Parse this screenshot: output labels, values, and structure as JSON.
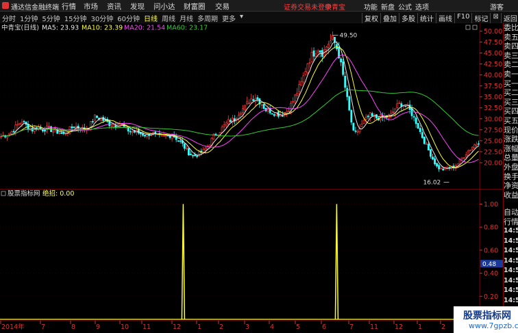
{
  "titlebar": {
    "app_name": "通达信金融终端",
    "menu": [
      "行情",
      "市场",
      "资讯",
      "发现",
      "问小达",
      "财富圈",
      "交易"
    ],
    "notice": "证券交易未登录",
    "stock_name": "中青宝",
    "right_links": [
      "功能",
      "新盘",
      "公式",
      "选项"
    ],
    "guest": "游客"
  },
  "period_bar": {
    "items": [
      "分时",
      "1分钟",
      "5分钟",
      "15分钟",
      "30分钟",
      "60分钟",
      "日线",
      "周线",
      "月线",
      "多周期",
      "更多"
    ],
    "active": "日线",
    "right_tools": [
      "复权",
      "叠加",
      "多股",
      "统计",
      "画线",
      "F10",
      "标记",
      "返回"
    ]
  },
  "kline": {
    "stock_label": "中青宝(日线)",
    "ma_legend": [
      {
        "name": "MA5",
        "value": "23.93",
        "color": "#e8e8e8"
      },
      {
        "name": "MA10",
        "value": "23.39",
        "color": "#ffff33"
      },
      {
        "name": "MA20",
        "value": "21.54",
        "color": "#ff44ff"
      },
      {
        "name": "MA60",
        "value": "23.17",
        "color": "#33cc33"
      }
    ],
    "high_label": "49.50",
    "low_label": "16.02"
  },
  "indicator": {
    "title": "股票指标网",
    "signal_label": "绝招: 0.00",
    "current_value_tag": "0.48"
  },
  "time_axis": [
    "2014年",
    "7",
    "8",
    "9",
    "10",
    "11",
    "12",
    "1",
    "2",
    "3",
    "4",
    "5",
    "6",
    "7",
    "11",
    "12",
    "1",
    "2",
    "3"
  ],
  "side_panel": {
    "items": [
      "委比",
      "卖五",
      "卖四",
      "卖三",
      "卖二",
      "卖一",
      "买一",
      "买二",
      "买三",
      "买四",
      "买五",
      "现价",
      "涨跌",
      "涨幅",
      "总量",
      "外盘",
      "换手",
      "净资",
      "收益"
    ],
    "trade_items": [
      "自动",
      "行情"
    ],
    "times": [
      "14:50",
      "14:50",
      "14:50",
      "14:50",
      "14:50",
      "14:50",
      "14:50",
      "14:50"
    ]
  },
  "watermark": {
    "text": "股票指标网",
    "url": "www.7gpzb.com"
  },
  "chart_data": {
    "type": "candlestick",
    "ylim": [
      15,
      51
    ],
    "price_ticks": [
      50,
      47.5,
      45,
      42.5,
      40,
      37.5,
      35,
      32.5,
      30,
      27.5,
      25,
      22.5,
      20
    ],
    "price_tick_labels": [
      "50.00",
      "47.50",
      "45.00",
      "42.50",
      "40.00",
      "37.50",
      "35.00",
      "32.50",
      "30.00",
      "27.50",
      "25.00",
      "22.50",
      "20.00"
    ],
    "high": 49.5,
    "low": 16.02,
    "close_profile": [
      26.0,
      26.4,
      27.0,
      28.4,
      29.5,
      28.3,
      27.5,
      28.1,
      27.6,
      27.9,
      27.3,
      27.0,
      26.5,
      27.4,
      28.3,
      28.0,
      27.6,
      28.3,
      30.4,
      30.2,
      29.5,
      28.8,
      28.6,
      28.9,
      27.7,
      27.1,
      27.0,
      26.6,
      26.3,
      26.9,
      26.0,
      25.8,
      26.1,
      26.4,
      25.3,
      24.1,
      22.4,
      21.5,
      21.9,
      22.7,
      24.1,
      26.1,
      27.1,
      28.4,
      29.6,
      29.9,
      31.8,
      32.6,
      34.5,
      35.0,
      33.8,
      32.1,
      31.8,
      31.2,
      31.0,
      31.7,
      33.4,
      36.0,
      38.5,
      42.7,
      44.7,
      46.2,
      45.0,
      47.2,
      48.2,
      45.1,
      39.1,
      32.3,
      26.2,
      27.7,
      29.4,
      30.8,
      30.2,
      30.3,
      30.5,
      30.6,
      32.5,
      33.6,
      32.9,
      31.5,
      29.2,
      26.3,
      23.7,
      21.3,
      19.0,
      18.4,
      18.8,
      18.9,
      19.8,
      21.3,
      22.7,
      23.9,
      24.7
    ],
    "ma_series": [
      "MA5",
      "MA10",
      "MA20",
      "MA60"
    ],
    "indicator_axis": {
      "ylim": [
        0,
        1.05
      ],
      "ticks": [
        1.0,
        0.8,
        0.6,
        0.4,
        0.2,
        0.0
      ],
      "tick_labels": [
        "1.00",
        "0.80",
        "0.60",
        "0.40",
        "0.20",
        "0.00"
      ],
      "current_value": 0.48,
      "spikes": [
        {
          "x_fraction": 0.382,
          "value": 1.0
        },
        {
          "x_fraction": 0.702,
          "value": 1.0
        }
      ]
    }
  }
}
